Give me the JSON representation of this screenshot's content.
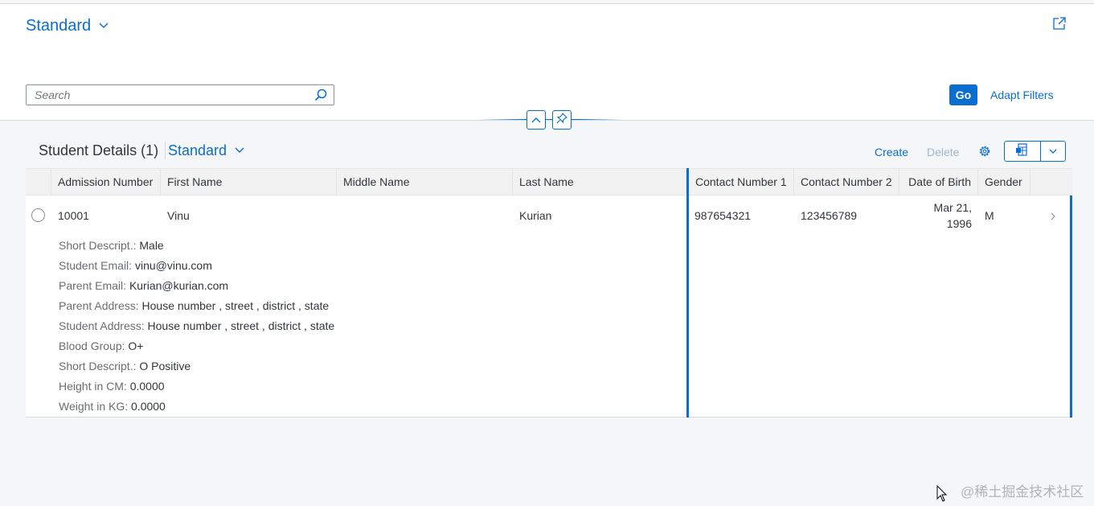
{
  "header": {
    "variant_title": "Standard",
    "search_placeholder": "Search",
    "go_label": "Go",
    "adapt_filters_label": "Adapt Filters"
  },
  "table": {
    "title": "Student Details (1)",
    "variant": "Standard",
    "create_label": "Create",
    "delete_label": "Delete",
    "columns": [
      "Admission Number",
      "First Name",
      "Middle Name",
      "Last Name",
      "Contact Number 1",
      "Contact Number 2",
      "Date of Birth",
      "Gender"
    ],
    "rows": [
      {
        "admission_number": "10001",
        "first_name": "Vinu",
        "middle_name": "",
        "last_name": "Kurian",
        "contact_1": "987654321",
        "contact_2": "123456789",
        "dob_line1": "Mar 21,",
        "dob_line2": "1996",
        "gender": "M",
        "details": [
          {
            "label": "Short Descript.:",
            "value": "Male"
          },
          {
            "label": "Student Email:",
            "value": "vinu@vinu.com"
          },
          {
            "label": "Parent Email:",
            "value": "Kurian@kurian.com"
          },
          {
            "label": "Parent Address:",
            "value": "House number , street , district , state"
          },
          {
            "label": "Student Address:",
            "value": "House number , street , district , state"
          },
          {
            "label": "Blood Group:",
            "value": "O+"
          },
          {
            "label": "Short Descript.:",
            "value": "O Positive"
          },
          {
            "label": "Height in CM:",
            "value": "0.0000"
          },
          {
            "label": "Weight in KG:",
            "value": "0.0000"
          }
        ]
      }
    ]
  },
  "watermark": "@稀土掘金技术社区",
  "colors": {
    "accent": "#0a6ed1",
    "text": "#32363a",
    "label": "#6a6d70",
    "disabled": "#9fb6cd",
    "background": "#f5f6f7"
  }
}
